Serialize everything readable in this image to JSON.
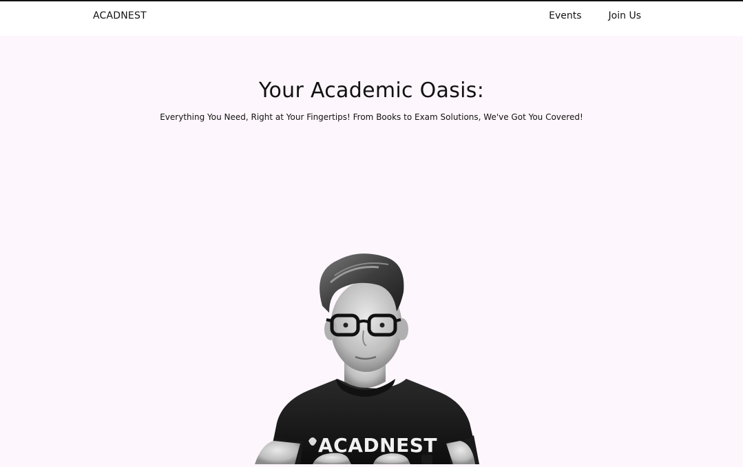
{
  "navbar": {
    "brand": "ACADNEST",
    "links": [
      {
        "label": "Events"
      },
      {
        "label": "Join Us"
      }
    ]
  },
  "hero": {
    "title": "Your Academic Oasis:",
    "subtitle": "Everything You Need, Right at Your Fingertips! From Books to Exam Solutions, We've Got You Covered!",
    "shirt_text": "ACADNEST"
  },
  "colors": {
    "page_background": "#fdf6fc",
    "navbar_background": "#ffffff",
    "text": "#111111"
  }
}
